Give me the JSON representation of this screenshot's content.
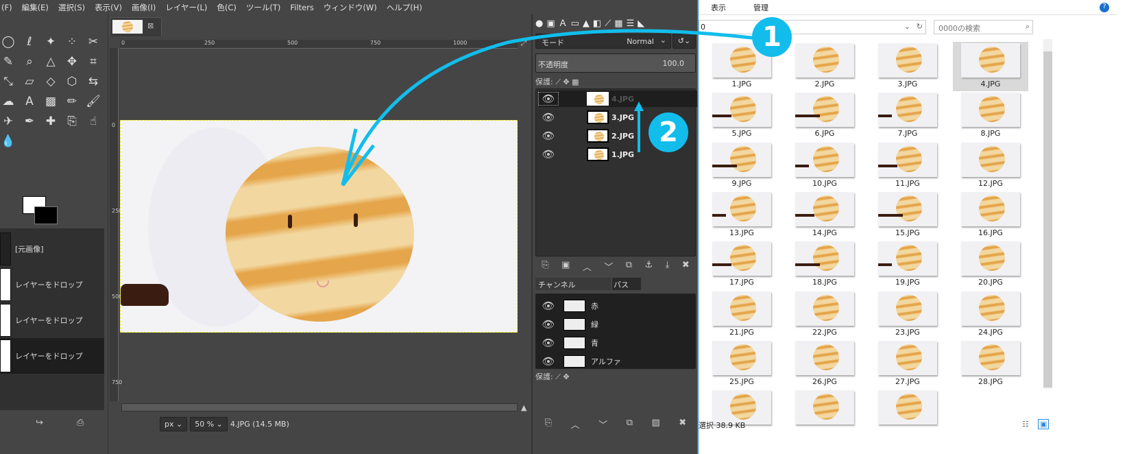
{
  "menu": [
    "(F)",
    "編集(E)",
    "選択(S)",
    "表示(V)",
    "画像(I)",
    "レイヤー(L)",
    "色(C)",
    "ツール(T)",
    "Filters",
    "ウィンドウ(W)",
    "ヘルプ(H)"
  ],
  "tools": [
    "ellipse-select",
    "lasso",
    "fuzzy-select",
    "select-by-color",
    "scissors",
    "foreground-select",
    "color-picker",
    "zoom",
    "measure",
    "move",
    "crop",
    "rotate",
    "scale",
    "shear",
    "perspective",
    "3d-transform",
    "flip",
    "cage",
    "warp",
    "text",
    "blend",
    "pencil",
    "paintbrush",
    "eraser",
    "airbrush",
    "ink",
    "heal",
    "clone",
    "smudge",
    "dodge",
    "bucket-fill"
  ],
  "undo": {
    "items": [
      "[元画像]",
      "レイヤーをドロップ",
      "レイヤーをドロップ",
      "レイヤーをドロップ"
    ]
  },
  "canvas": {
    "tab_close": "⊠",
    "ruler_h": [
      "0",
      "250",
      "500",
      "750",
      "1000"
    ],
    "ruler_v": [
      "0",
      "250",
      "500",
      "750"
    ]
  },
  "status": {
    "unit": "px",
    "zoom": "50 %",
    "file": "4.JPG (14.5 MB)"
  },
  "layers": {
    "mode_label": "モード",
    "mode": "Normal",
    "opacity_label": "不透明度",
    "opacity": "100.0",
    "lock_label": "保護:",
    "items": [
      {
        "name": "4.JPG",
        "active": true
      },
      {
        "name": "3.JPG"
      },
      {
        "name": "2.JPG"
      },
      {
        "name": "1.JPG"
      }
    ]
  },
  "channels": {
    "tab": "チャンネル",
    "paths_tab": "パス",
    "lock_label": "保護:",
    "items": [
      "赤",
      "緑",
      "青",
      "アルファ"
    ]
  },
  "explorer": {
    "ribbon": [
      "表示",
      "管理"
    ],
    "address": "0",
    "search_placeholder": "0000の検索",
    "status": "選択  38.9 KB",
    "selected": "4.JPG",
    "files": [
      "1.JPG",
      "2.JPG",
      "3.JPG",
      "4.JPG",
      "5.JPG",
      "6.JPG",
      "7.JPG",
      "8.JPG",
      "9.JPG",
      "10.JPG",
      "11.JPG",
      "12.JPG",
      "13.JPG",
      "14.JPG",
      "15.JPG",
      "16.JPG",
      "17.JPG",
      "18.JPG",
      "19.JPG",
      "20.JPG",
      "21.JPG",
      "22.JPG",
      "23.JPG",
      "24.JPG",
      "25.JPG",
      "26.JPG",
      "27.JPG",
      "28.JPG",
      "",
      "",
      " "
    ]
  },
  "annotations": {
    "step1": "1",
    "step2": "2",
    "color": "#12bdec"
  }
}
